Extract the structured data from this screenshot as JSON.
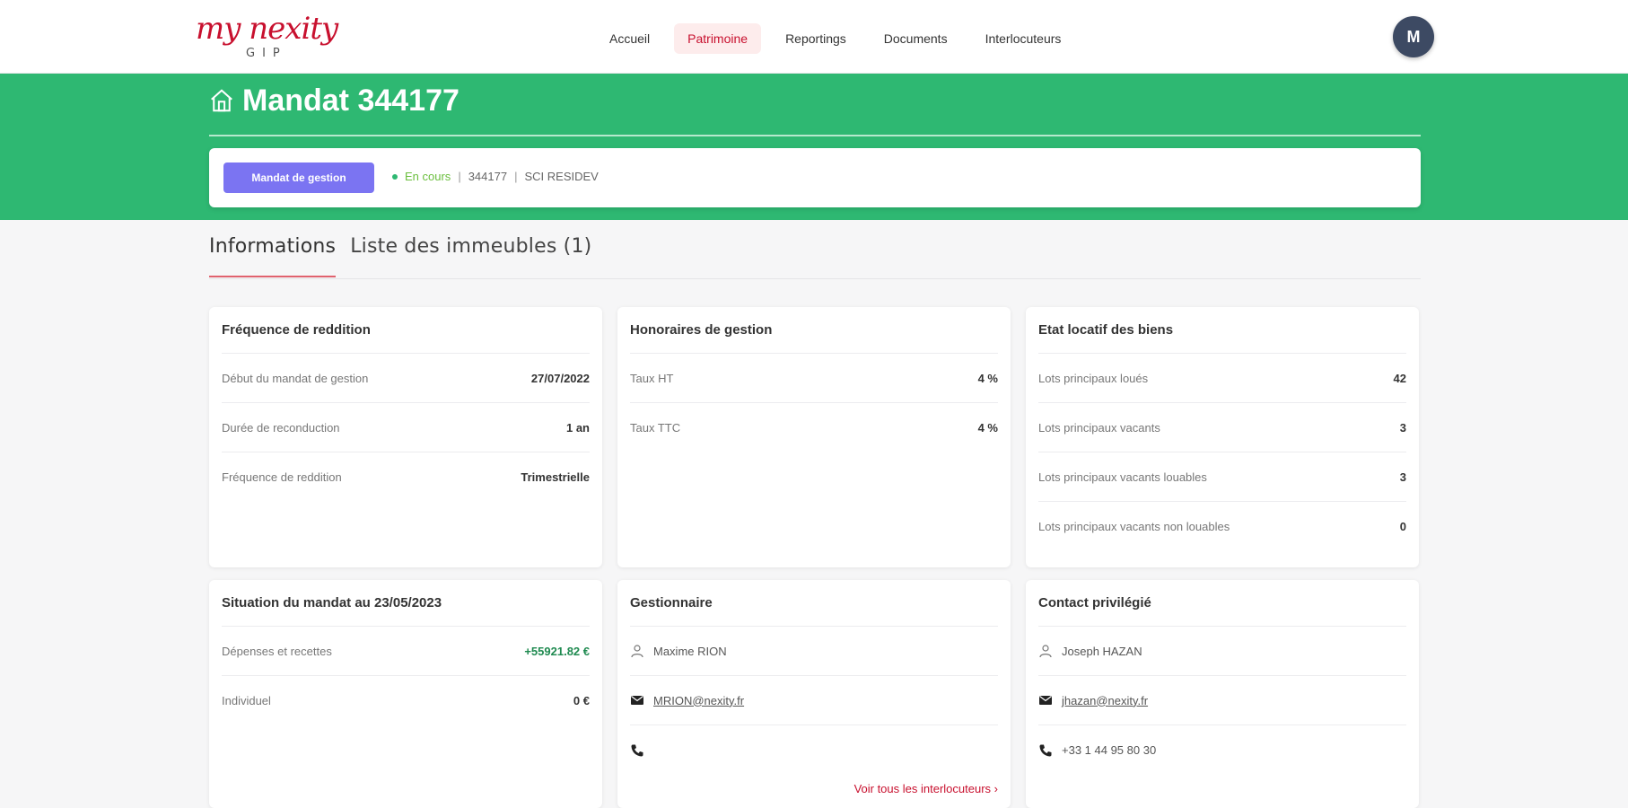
{
  "header": {
    "logo_text": "my nexity",
    "logo_sub": "GIP",
    "nav": [
      {
        "label": "Accueil"
      },
      {
        "label": "Patrimoine",
        "active": true
      },
      {
        "label": "Reportings"
      },
      {
        "label": "Documents"
      },
      {
        "label": "Interlocuteurs"
      }
    ],
    "avatar_initial": "M"
  },
  "hero": {
    "icon": "home-icon",
    "title": "Mandat 344177",
    "button_label": "Mandat de gestion",
    "status": "En cours",
    "mandat_number": "344177",
    "owner": "SCI RESIDEV"
  },
  "tabs": [
    {
      "label": "Informations",
      "active": true
    },
    {
      "label": "Liste des immeubles (1)"
    }
  ],
  "cards": {
    "reddition": {
      "title": "Fréquence de reddition",
      "rows": [
        {
          "label": "Début du mandat de gestion",
          "value": "27/07/2022"
        },
        {
          "label": "Durée de reconduction",
          "value": "1 an"
        },
        {
          "label": "Fréquence de reddition",
          "value": "Trimestrielle"
        }
      ]
    },
    "honoraires": {
      "title": "Honoraires de gestion",
      "rows": [
        {
          "label": "Taux HT",
          "value": "4 %"
        },
        {
          "label": "Taux TTC",
          "value": "4 %"
        }
      ]
    },
    "etat": {
      "title": "Etat locatif des biens",
      "rows": [
        {
          "label": "Lots principaux loués",
          "value": "42"
        },
        {
          "label": "Lots principaux vacants",
          "value": "3"
        },
        {
          "label": "Lots principaux vacants louables",
          "value": "3"
        },
        {
          "label": "Lots principaux vacants non louables",
          "value": "0"
        }
      ]
    },
    "situation": {
      "title": "Situation du mandat au 23/05/2023",
      "rows": [
        {
          "label": "Dépenses et recettes",
          "value": "+55921.82 €"
        },
        {
          "label": "Individuel",
          "value": "0 €"
        }
      ]
    },
    "gestionnaire": {
      "title": "Gestionnaire",
      "name": "Maxime RION",
      "email": "MRION@nexity.fr",
      "phone": "",
      "link": "Voir tous les interlocuteurs"
    },
    "contact": {
      "title": "Contact privilégié",
      "name": "Joseph HAZAN",
      "email": "jhazan@nexity.fr",
      "phone": "+33 1 44 95 80 30"
    }
  },
  "colors": {
    "brand": "#c8102e",
    "band": "#2eb872",
    "button": "#7b74f2",
    "avatar": "#3d4a63"
  }
}
